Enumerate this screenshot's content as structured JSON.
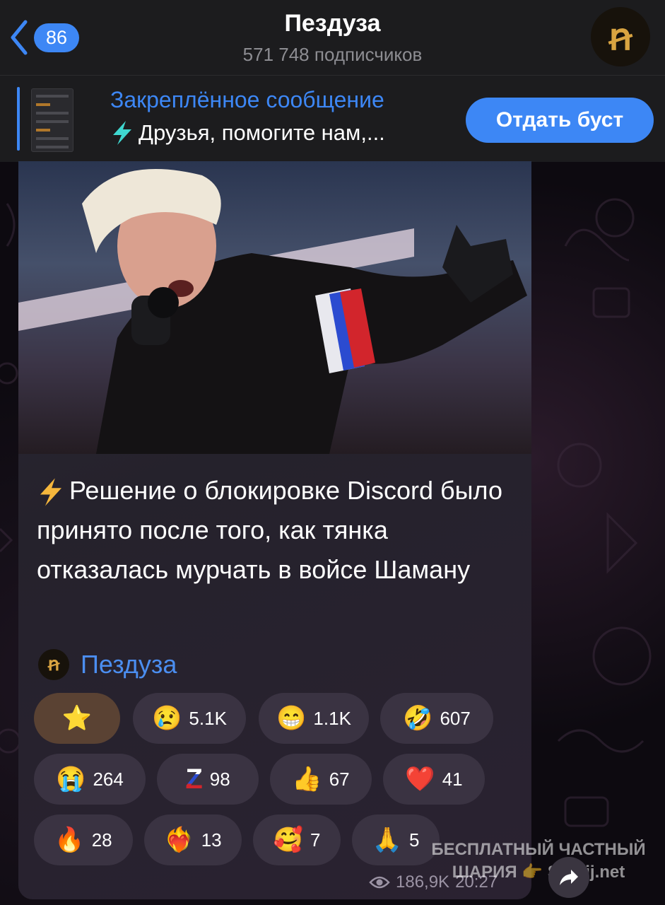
{
  "header": {
    "back_count": "86",
    "title": "Пездуза",
    "subscribers": "571 748 подписчиков",
    "avatar_letter": "ꞥ"
  },
  "pinned": {
    "title": "Закреплённое сообщение",
    "text": "Друзья, помогите нам,...",
    "boost_label": "Отдать буст"
  },
  "post": {
    "text": "Решение о блокировке Discord было принято после того, как тянка отказалась мурчать в войсе Шаману",
    "signature": "Пездуза",
    "views": "186,9K",
    "time": "20:27"
  },
  "reactions": [
    {
      "emoji": "⭐",
      "count": ""
    },
    {
      "emoji": "😢",
      "count": "5.1K"
    },
    {
      "emoji": "😁",
      "count": "1.1K"
    },
    {
      "emoji": "🤣",
      "count": "607"
    },
    {
      "emoji": "😭",
      "count": "264"
    },
    {
      "emoji": "Z",
      "count": "98"
    },
    {
      "emoji": "👍",
      "count": "67"
    },
    {
      "emoji": "❤️",
      "count": "41"
    },
    {
      "emoji": "🔥",
      "count": "28"
    },
    {
      "emoji": "❤️‍🔥",
      "count": "13"
    },
    {
      "emoji": "🥰",
      "count": "7"
    },
    {
      "emoji": "🙏",
      "count": "5"
    }
  ],
  "watermark": {
    "line1": "БЕСПЛАТНЫЙ ЧАСТНЫЙ",
    "line2": "ШАРИЯ 👉 Sharij.net"
  },
  "colors": {
    "accent": "#3d87f5",
    "header_bg": "#1c1c1e",
    "bubble_bg": "#2a2531",
    "reaction_bg": "#3a3342"
  }
}
